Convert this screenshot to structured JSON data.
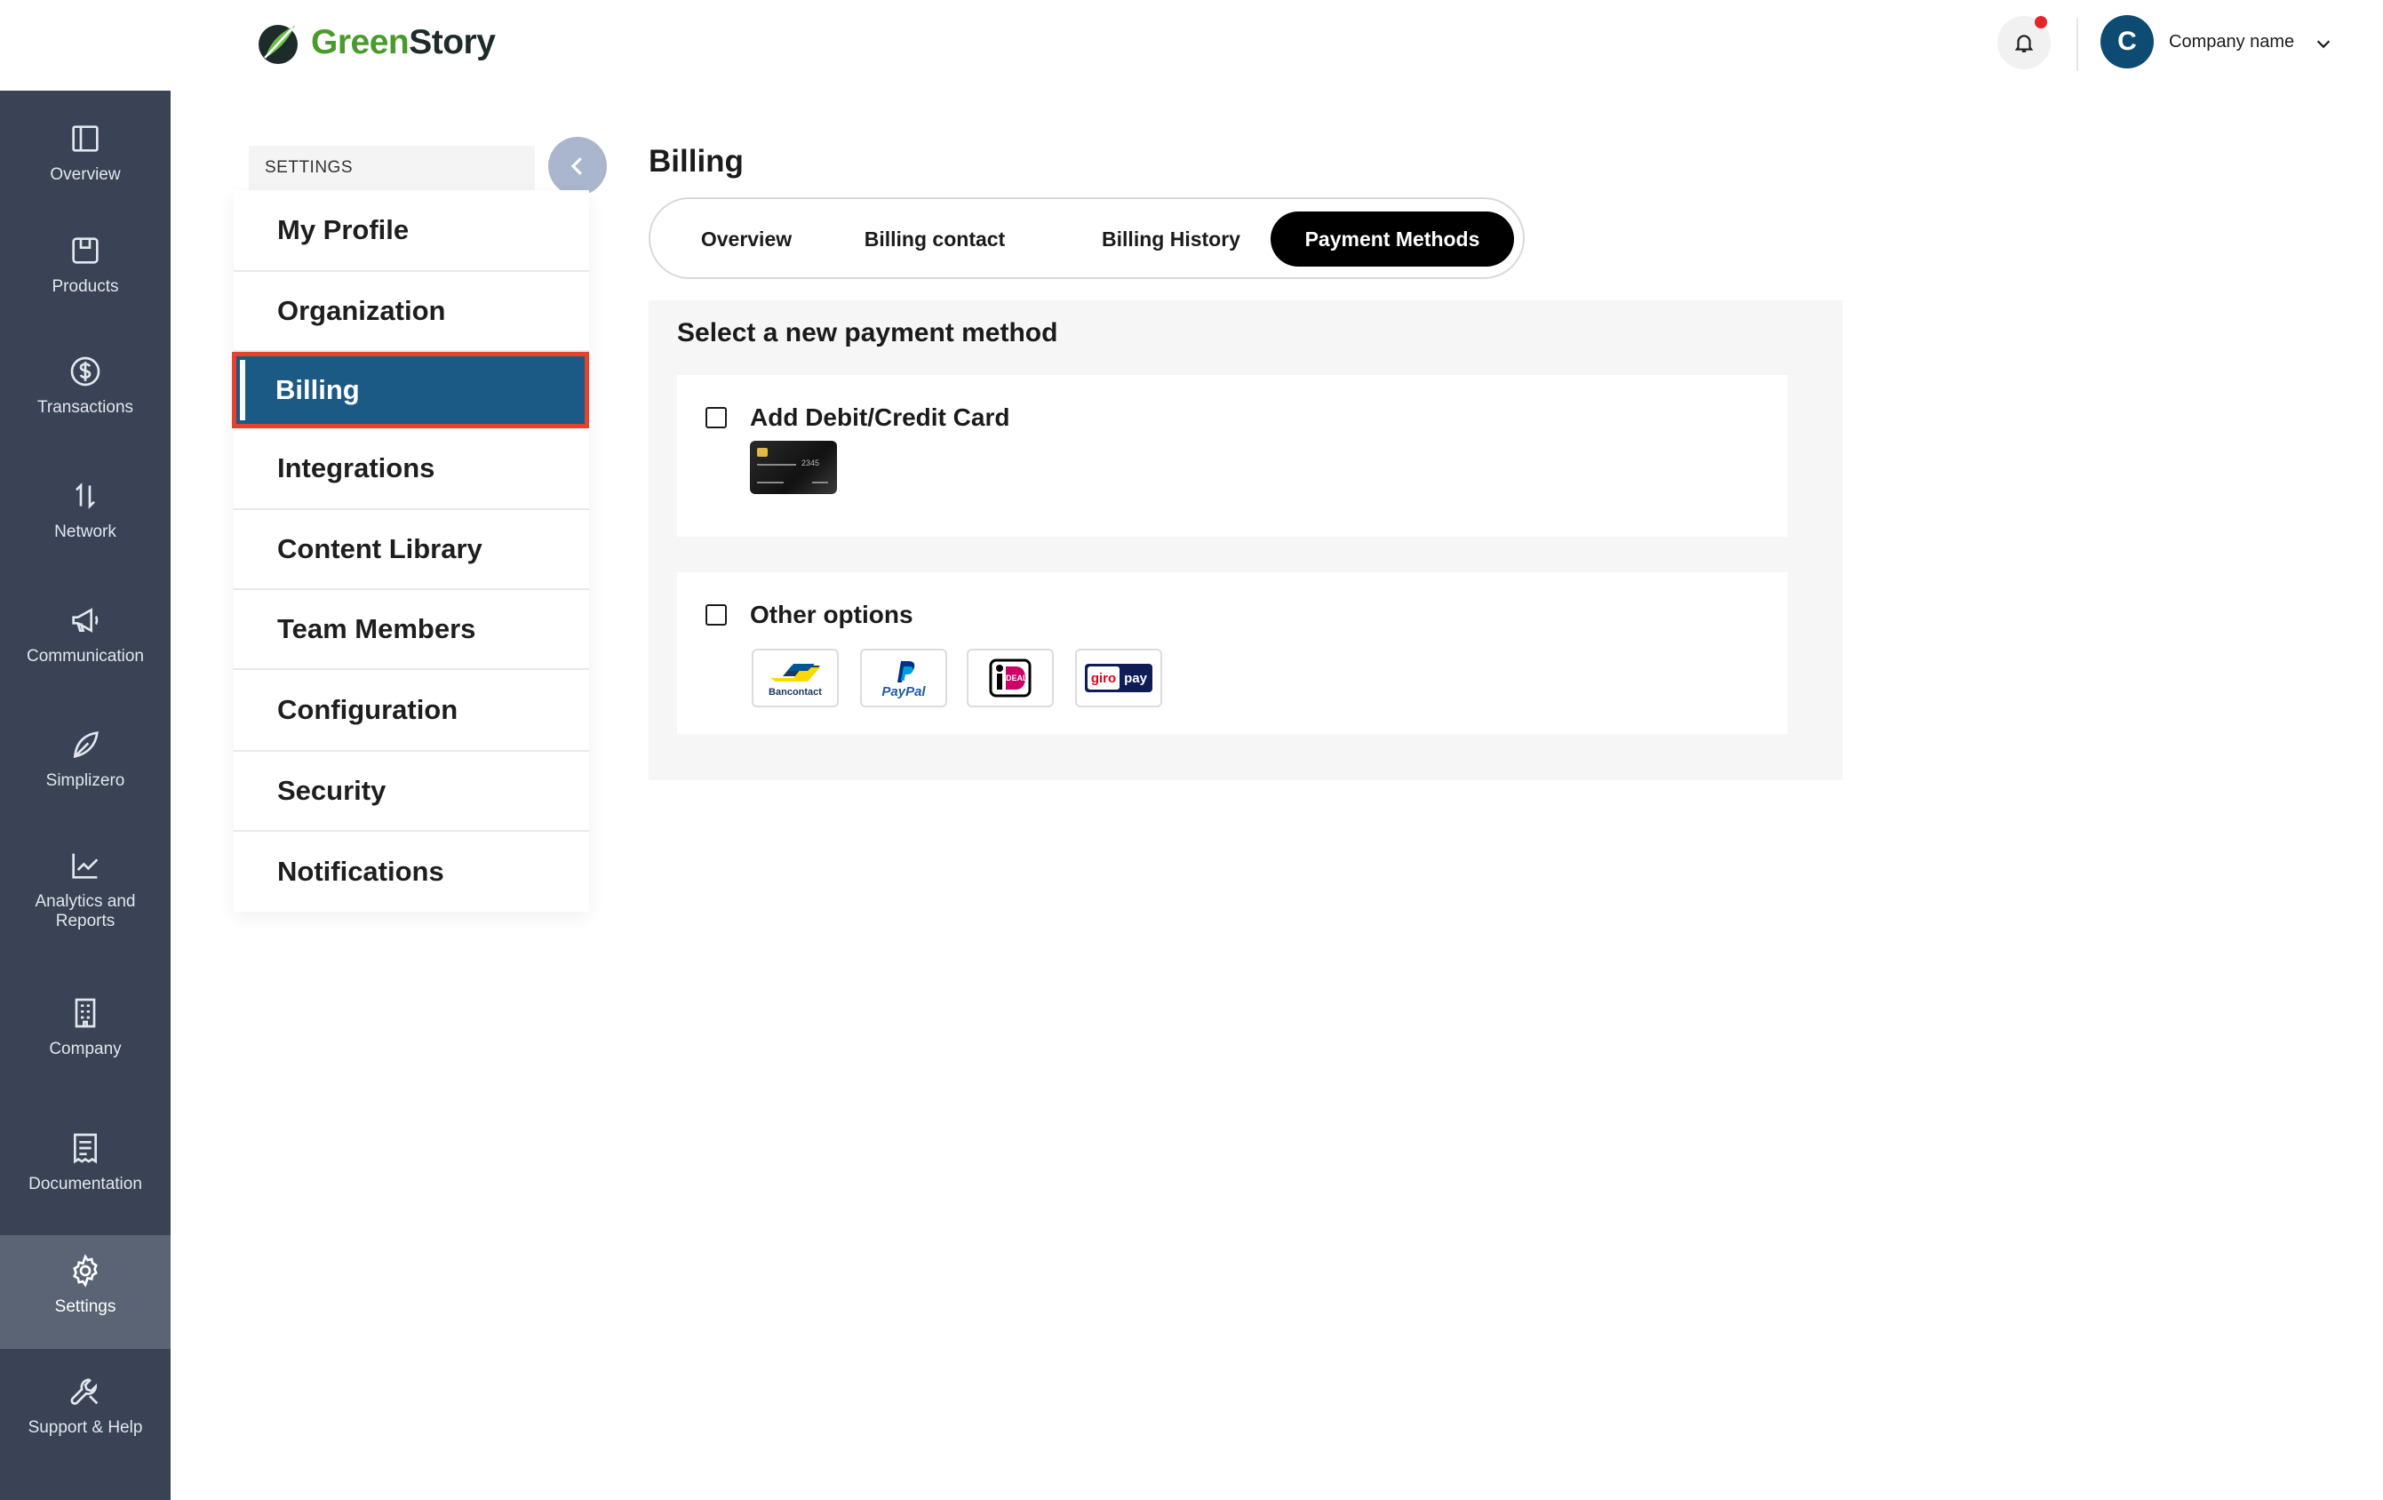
{
  "header": {
    "logo_green": "Green",
    "logo_dark": "Story",
    "avatar_initial": "C",
    "company_name": "Company name"
  },
  "rail": {
    "items": [
      {
        "label": "Overview",
        "icon": "panel-icon"
      },
      {
        "label": "Products",
        "icon": "box-icon"
      },
      {
        "label": "Transactions",
        "icon": "dollar-circle-icon"
      },
      {
        "label": "Network",
        "icon": "arrows-up-down-icon"
      },
      {
        "label": "Communication",
        "icon": "megaphone-icon"
      },
      {
        "label": "Simplizero",
        "icon": "leaf-icon"
      },
      {
        "label": "Analytics and",
        "label2": "Reports",
        "icon": "line-chart-icon"
      },
      {
        "label": "Company",
        "icon": "building-icon"
      },
      {
        "label": "Documentation",
        "icon": "receipt-icon"
      },
      {
        "label": "Settings",
        "icon": "gear-icon",
        "active": true
      },
      {
        "label": "Support & Help",
        "icon": "wrench-icon"
      }
    ]
  },
  "settings": {
    "heading": "SETTINGS",
    "items": [
      {
        "label": "My Profile"
      },
      {
        "label": "Organization"
      },
      {
        "label": "Billing",
        "active": true
      },
      {
        "label": "Integrations"
      },
      {
        "label": "Content Library"
      },
      {
        "label": "Team Members"
      },
      {
        "label": "Configuration"
      },
      {
        "label": "Security"
      },
      {
        "label": "Notifications"
      }
    ]
  },
  "main": {
    "title": "Billing",
    "tabs": [
      {
        "label": "Overview"
      },
      {
        "label": "Billing contact"
      },
      {
        "label": "Billing History"
      },
      {
        "label": "Payment Methods",
        "active": true
      }
    ],
    "panel_title": "Select a new payment method",
    "options": [
      {
        "label": "Add Debit/Credit Card",
        "checked": false
      },
      {
        "label": "Other options",
        "checked": false
      }
    ],
    "card_number_tail": "2345",
    "payment_logos": [
      {
        "name": "Bancontact",
        "text": "Bancontact"
      },
      {
        "name": "PayPal",
        "text": "PayPal"
      },
      {
        "name": "iDEAL",
        "text": "iDEAL"
      },
      {
        "name": "giropay",
        "text_a": "giro",
        "text_b": "pay"
      }
    ],
    "colors": {
      "rail_bg": "#394355",
      "active_item": "#1a5a85",
      "highlight_border": "#e5432e",
      "brand_green": "#4a9a2c"
    }
  }
}
